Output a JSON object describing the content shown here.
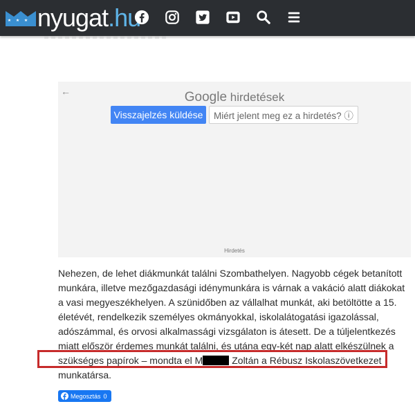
{
  "header": {
    "logo_main": "nyugat",
    "logo_tld": ".hu",
    "nav_icons": [
      "facebook-icon",
      "instagram-icon",
      "twitter-icon",
      "youtube-icon",
      "search-icon",
      "menu-icon"
    ]
  },
  "ad": {
    "back_glyph": "←",
    "brand": "Google",
    "brand_suffix": "hirdetések",
    "feedback_button": "Visszajelzés küldése",
    "why_button": "Miért jelent meg ez a hirdetés? ⓘ",
    "label": "Hirdetés"
  },
  "article": {
    "paragraph_part1": "Nehezen, de lehet diákmunkát találni Szombathelyen. Nagyobb cégek betanított munkára, illetve mezőgazdasági idénymunkára is várnak a vakáció alatt diákokat a vasi megyeszékhelyen. A szünidőben az vállalhat munkát, aki betöltötte a 15. életévét, rendelkezik személyes okmányokkal, iskolalátogatási igazolással, adószámmal, és orvosi alkalmassági vizsgálaton is átesett. De a túljelentkezés miatt először érdemes munkát találni, és utána egy-két nap alatt elkészülnek a szükséges papírok – mondta el M",
    "paragraph_part2": " Zoltán a Rébusz Iskolaszövetkezet munkatársa."
  },
  "share": {
    "label": "Megosztás",
    "count": "0"
  },
  "colors": {
    "header_bg": "#2b2e32",
    "logo_accent": "#5fb4e8",
    "ad_primary": "#4285f4",
    "highlight": "#c62b2b",
    "facebook": "#1877f2"
  }
}
